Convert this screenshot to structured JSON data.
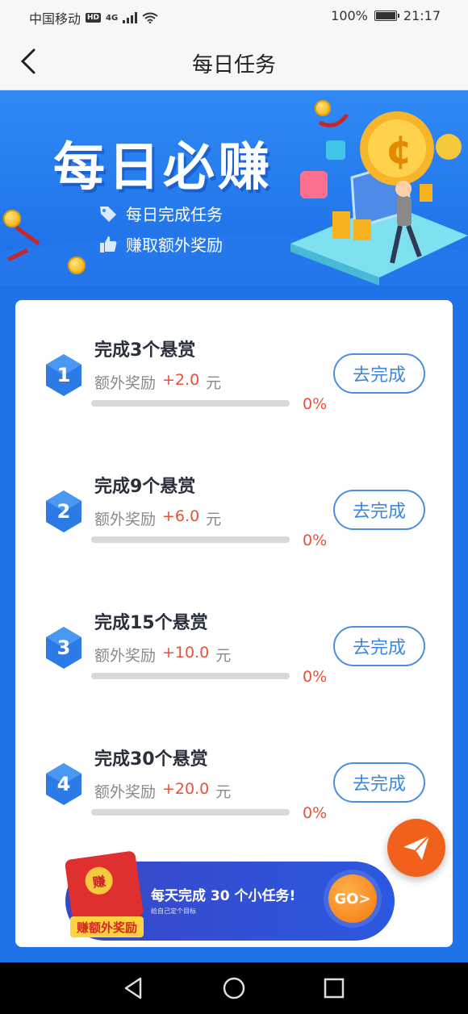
{
  "status_bar": {
    "carrier": "中国移动",
    "hd_badge": "HD",
    "network": "4G",
    "battery_percent": "100%",
    "battery_level": 1.0,
    "time": "21:17"
  },
  "nav": {
    "title": "每日任务"
  },
  "banner": {
    "title": "每日必赚",
    "line1": "每日完成任务",
    "line2": "赚取额外奖励"
  },
  "tasks": [
    {
      "number": "1",
      "title": "完成3个悬赏",
      "reward_label": "额外奖励",
      "reward_amount": "+2.0",
      "reward_unit": "元",
      "progress_text": "0%",
      "progress": 0,
      "button_label": "去完成"
    },
    {
      "number": "2",
      "title": "完成9个悬赏",
      "reward_label": "额外奖励",
      "reward_amount": "+6.0",
      "reward_unit": "元",
      "progress_text": "0%",
      "progress": 0,
      "button_label": "去完成"
    },
    {
      "number": "3",
      "title": "完成15个悬赏",
      "reward_label": "额外奖励",
      "reward_amount": "+10.0",
      "reward_unit": "元",
      "progress_text": "0%",
      "progress": 0,
      "button_label": "去完成"
    },
    {
      "number": "4",
      "title": "完成30个悬赏",
      "reward_label": "额外奖励",
      "reward_amount": "+20.0",
      "reward_unit": "元",
      "progress_text": "0%",
      "progress": 0,
      "button_label": "去完成"
    }
  ],
  "promo": {
    "seal": "赚",
    "tag": "赚额外奖励",
    "main_text": "每天完成 30 个小任务!",
    "sub_text": "给自己定个目标",
    "go_label": "GO>"
  },
  "colors": {
    "primary_blue": "#1f73e8",
    "accent_red": "#e8503a",
    "button_border": "#4a8fde",
    "fab_orange": "#f2611b"
  },
  "icons": {
    "back": "chevron-left-icon",
    "tag": "tag-icon",
    "thumb": "thumbs-up-icon",
    "send": "paper-plane-icon",
    "sys_back": "triangle-back-icon",
    "sys_home": "circle-home-icon",
    "sys_recent": "square-recent-icon"
  }
}
